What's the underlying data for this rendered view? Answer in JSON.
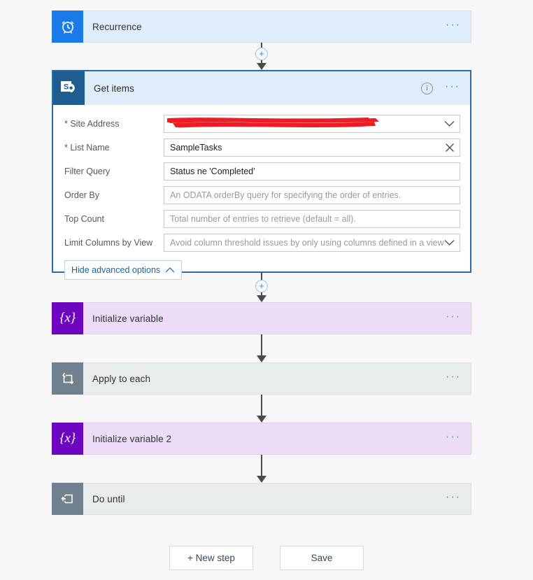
{
  "flow": {
    "steps": [
      {
        "id": "recurrence",
        "title": "Recurrence",
        "icon": "alarm-clock-icon",
        "menu": "···"
      },
      {
        "id": "getitems",
        "title": "Get items",
        "icon": "sharepoint-icon",
        "menu": "···",
        "info": "i"
      },
      {
        "id": "initvar",
        "title": "Initialize variable",
        "icon": "variable-icon",
        "menu": "···"
      },
      {
        "id": "applyeach",
        "title": "Apply to each",
        "icon": "loop-icon",
        "menu": "···"
      },
      {
        "id": "initvar2",
        "title": "Initialize variable 2",
        "icon": "variable-icon",
        "menu": "···"
      },
      {
        "id": "dountil",
        "title": "Do until",
        "icon": "do-until-icon",
        "menu": "···"
      }
    ]
  },
  "get_items": {
    "title": "Get items",
    "fields": {
      "site_address": {
        "label": "* Site Address",
        "value": "",
        "redacted": true,
        "affix": "chevron-down"
      },
      "list_name": {
        "label": "* List Name",
        "value": "SampleTasks",
        "affix": "clear-x"
      },
      "filter_query": {
        "label": "Filter Query",
        "value": "Status ne 'Completed'",
        "affix": ""
      },
      "order_by": {
        "label": "Order By",
        "placeholder": "An ODATA orderBy query for specifying the order of entries.",
        "affix": ""
      },
      "top_count": {
        "label": "Top Count",
        "placeholder": "Total number of entries to retrieve (default = all).",
        "affix": ""
      },
      "limit_columns_by_view": {
        "label": "Limit Columns by View",
        "placeholder": "Avoid column threshold issues by only using columns defined in a view",
        "affix": "chevron-down"
      }
    },
    "advanced_options_button": "Hide advanced options"
  },
  "connectors": {
    "plus_label": "+"
  },
  "footer": {
    "new_step": "+ New step",
    "save": "Save"
  },
  "colors": {
    "page_background": "#f7f7f7",
    "recurrence_icon": "#1a7ae8",
    "recurrence_body": "#dfedfb",
    "sharepoint_icon": "#1f5c8f",
    "variable_icon": "#6d06bf",
    "variable_body": "#ecdcf8",
    "loop_icon": "#70808f",
    "loop_body": "#e8eced",
    "selected_border": "#2c6ba3",
    "redaction": "#ed1c24",
    "link_blue": "#17659b"
  }
}
